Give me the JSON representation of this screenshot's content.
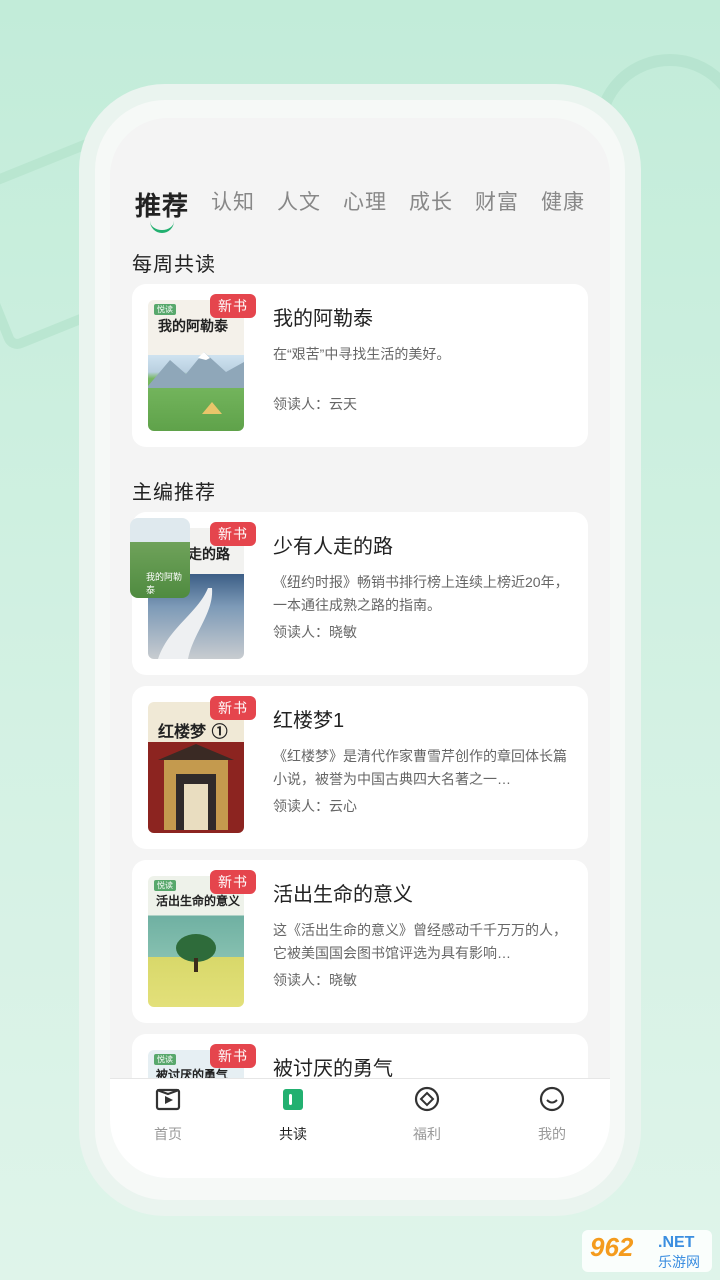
{
  "tabs": [
    "推荐",
    "认知",
    "人文",
    "心理",
    "成长",
    "财富",
    "健康"
  ],
  "sections": {
    "weekly": "每周共读",
    "editor": "主编推荐"
  },
  "badge": "新书",
  "leader_prefix": "领读人：",
  "books": [
    {
      "title": "我的阿勒泰",
      "desc": "在“艰苦”中寻找生活的美好。",
      "leader": "云天",
      "cover_text": "我的阿勒泰"
    },
    {
      "title": "少有人走的路",
      "desc": "《纽约时报》畅销书排行榜上连续上榜近20年，一本通往成熟之路的指南。",
      "leader": "晓敏",
      "cover_text": "走的路",
      "overlay_text": "我的阿勒泰"
    },
    {
      "title": "红楼梦1",
      "desc": "《红楼梦》是清代作家曹雪芹创作的章回体长篇小说，被誉为中国古典四大名著之一…",
      "leader": "云心",
      "cover_text": "红楼梦",
      "cover_num": "①"
    },
    {
      "title": "活出生命的意义",
      "desc": "这《活出生命的意义》曾经感动千千万万的人，它被美国国会图书馆评选为具有影响…",
      "leader": "晓敏",
      "cover_text": "活出生命的意义"
    },
    {
      "title": "被讨厌的勇气",
      "desc": "",
      "leader": "",
      "cover_text": "被讨厌的勇气"
    }
  ],
  "nav": [
    "首页",
    "共读",
    "福利",
    "我的"
  ],
  "watermark": {
    "num": "962",
    "net": ".NET",
    "cn": "乐游网"
  },
  "colors": {
    "accent": "#22b070",
    "badge": "#e5454d",
    "bg": "#c2ecd9"
  }
}
